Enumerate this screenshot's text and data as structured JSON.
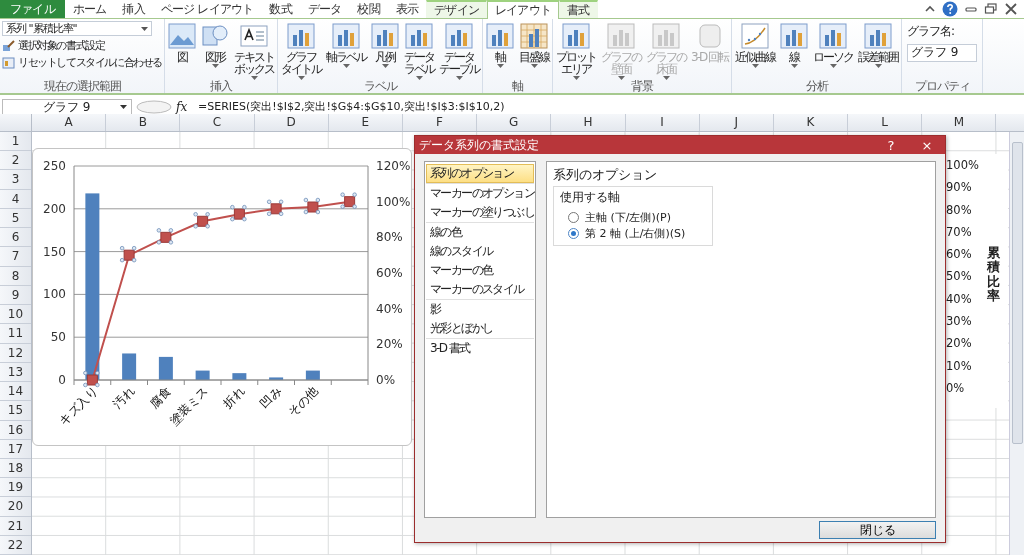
{
  "ribbon_tabs": [
    {
      "label": "ファイル",
      "kind": "file",
      "selected": false
    },
    {
      "label": "ホーム",
      "kind": "normal",
      "selected": false
    },
    {
      "label": "挿入",
      "kind": "normal",
      "selected": false
    },
    {
      "label": "ページ レイアウト",
      "kind": "normal",
      "selected": false
    },
    {
      "label": "数式",
      "kind": "normal",
      "selected": false
    },
    {
      "label": "データ",
      "kind": "normal",
      "selected": false
    },
    {
      "label": "校閲",
      "kind": "normal",
      "selected": false
    },
    {
      "label": "表示",
      "kind": "normal",
      "selected": false
    },
    {
      "label": "デザイン",
      "kind": "context",
      "selected": false
    },
    {
      "label": "レイアウト",
      "kind": "context",
      "selected": true
    },
    {
      "label": "書式",
      "kind": "context",
      "selected": false
    }
  ],
  "ribbon_groups": [
    {
      "label": "現在の選択範囲",
      "kind": "selection",
      "selector": "系列 \"累積比率\"",
      "commands": [
        "選択対象の書式設定",
        "リセットしてスタイルに合わせる"
      ]
    },
    {
      "label": "挿入",
      "kind": "buttons",
      "buttons": [
        {
          "lines": [
            "図"
          ],
          "kind": "picture",
          "dropdown": false,
          "disabled": false
        },
        {
          "lines": [
            "図形"
          ],
          "kind": "shape",
          "dropdown": true,
          "disabled": false
        },
        {
          "lines": [
            "テキスト",
            "ボックス"
          ],
          "kind": "textbox",
          "dropdown": true,
          "disabled": false
        }
      ]
    },
    {
      "label": "ラベル",
      "kind": "buttons",
      "buttons": [
        {
          "lines": [
            "グラフ",
            "タイトル"
          ],
          "kind": "chart",
          "dropdown": true,
          "disabled": false
        },
        {
          "lines": [
            "軸ラベル"
          ],
          "kind": "chart",
          "dropdown": true,
          "disabled": false
        },
        {
          "lines": [
            "凡例"
          ],
          "kind": "chart",
          "dropdown": true,
          "disabled": false
        },
        {
          "lines": [
            "データ",
            "ラベル"
          ],
          "kind": "chart",
          "dropdown": true,
          "disabled": false
        },
        {
          "lines": [
            "データ",
            "テーブル"
          ],
          "kind": "chart",
          "dropdown": true,
          "disabled": false
        }
      ]
    },
    {
      "label": "軸",
      "kind": "buttons",
      "buttons": [
        {
          "lines": [
            "軸"
          ],
          "kind": "chart",
          "dropdown": true,
          "disabled": false
        },
        {
          "lines": [
            "目盛線"
          ],
          "kind": "grid",
          "dropdown": true,
          "disabled": false
        }
      ]
    },
    {
      "label": "背景",
      "kind": "buttons",
      "buttons": [
        {
          "lines": [
            "プロット",
            "エリア"
          ],
          "kind": "chart",
          "dropdown": true,
          "disabled": false
        },
        {
          "lines": [
            "グラフの",
            "壁面"
          ],
          "kind": "chart",
          "dropdown": true,
          "disabled": true
        },
        {
          "lines": [
            "グラフの",
            "床面"
          ],
          "kind": "chart",
          "dropdown": true,
          "disabled": true
        },
        {
          "lines": [
            "3-D 回転"
          ],
          "kind": "cube",
          "dropdown": false,
          "disabled": true
        }
      ]
    },
    {
      "label": "分析",
      "kind": "buttons",
      "buttons": [
        {
          "lines": [
            "近似曲線"
          ],
          "kind": "trend",
          "dropdown": true,
          "disabled": false
        },
        {
          "lines": [
            "線"
          ],
          "kind": "chart",
          "dropdown": true,
          "disabled": false
        },
        {
          "lines": [
            "ローソク"
          ],
          "kind": "chart",
          "dropdown": true,
          "disabled": false
        },
        {
          "lines": [
            "誤差範囲"
          ],
          "kind": "chart",
          "dropdown": true,
          "disabled": false
        }
      ]
    },
    {
      "label": "プロパティ",
      "kind": "name",
      "field_label": "グラフ名:",
      "value": "グラフ 9"
    }
  ],
  "formula_bar": {
    "name_box": "グラフ 9",
    "function_label": "fx",
    "formula": "=SERIES(突出!$I$2,突出!$G$4:$G$10,突出!$I$3:$I$10,2)"
  },
  "columns": [
    "A",
    "B",
    "C",
    "D",
    "E",
    "F",
    "G",
    "H",
    "I",
    "J",
    "K",
    "L",
    "M"
  ],
  "rows": [
    "1",
    "2",
    "3",
    "4",
    "5",
    "6",
    "7",
    "8",
    "9",
    "10",
    "11",
    "12",
    "13",
    "14",
    "15",
    "16",
    "17",
    "18",
    "19",
    "20",
    "21",
    "22"
  ],
  "chart": {
    "chart_data": {
      "type": "bar",
      "grid": true,
      "categories": [
        "キズ入り",
        "汚れ",
        "腐食",
        "塗装ミス",
        "折れ",
        "凹み",
        "その他",
        null
      ],
      "series": [
        {
          "type": "bar",
          "color": "#4f81bd",
          "values": [
            218,
            31,
            27,
            11,
            8,
            3,
            11,
            null
          ]
        },
        {
          "type": "line",
          "axis": "y2",
          "marker": "square",
          "color": "#c0504d",
          "values": [
            0,
            70,
            80,
            89,
            93,
            96,
            97,
            100
          ]
        }
      ],
      "ylim": [
        0,
        250
      ],
      "yticks": [
        0,
        50,
        100,
        150,
        200,
        250
      ],
      "y2lim": [
        0,
        120
      ],
      "y2ticks": [
        {
          "value": 0,
          "label": "0%"
        },
        {
          "value": 20,
          "label": "20%"
        },
        {
          "value": 40,
          "label": "40%"
        },
        {
          "value": 60,
          "label": "60%"
        },
        {
          "value": 80,
          "label": "80%"
        },
        {
          "value": 100,
          "label": "100%"
        },
        {
          "value": 120,
          "label": "120%"
        }
      ]
    }
  },
  "secondary_chart": {
    "axis_labels": [
      "100%",
      "90%",
      "80%",
      "70%",
      "60%",
      "50%",
      "40%",
      "30%",
      "20%",
      "10%",
      "0%"
    ],
    "axis_title": "累積比率"
  },
  "dialog": {
    "title": "データ系列の書式設定",
    "help": "?",
    "close": "×",
    "nav_groups": [
      [
        {
          "label": "系列のオプション",
          "selected": true
        }
      ],
      [
        {
          "label": "マーカーのオプション",
          "selected": false
        },
        {
          "label": "マーカーの塗りつぶし",
          "selected": false
        }
      ],
      [
        {
          "label": "線の色",
          "selected": false
        },
        {
          "label": "線のスタイル",
          "selected": false
        },
        {
          "label": "マーカーの色",
          "selected": false
        },
        {
          "label": "マーカーのスタイル",
          "selected": false
        }
      ],
      [
        {
          "label": "影",
          "selected": false
        },
        {
          "label": "光彩とぼかし",
          "selected": false
        }
      ],
      [
        {
          "label": "3-D 書式",
          "selected": false
        }
      ]
    ],
    "heading": "系列のオプション",
    "fieldset": "使用する軸",
    "options": [
      {
        "label": "主軸 (下/左側)(P)",
        "selected": false
      },
      {
        "label": "第 2 軸 (上/右側)(S)",
        "selected": true
      }
    ],
    "close_button": "閉じる"
  }
}
